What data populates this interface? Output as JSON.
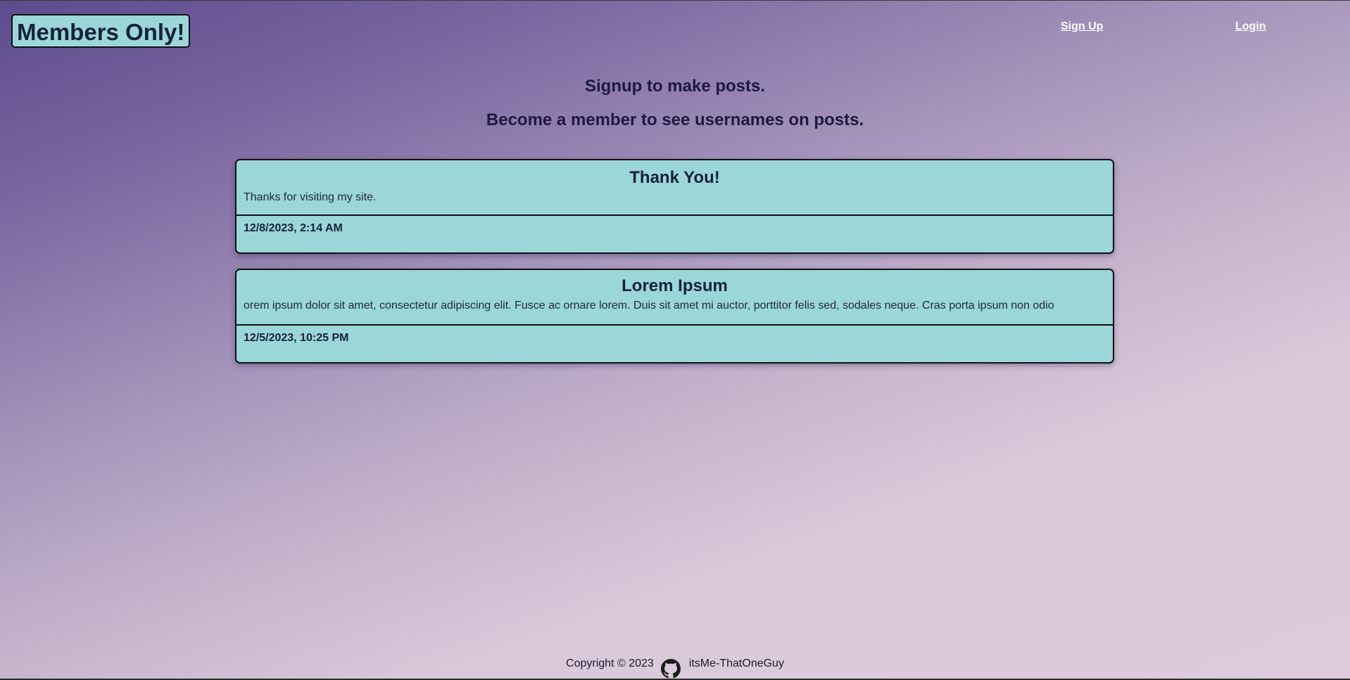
{
  "header": {
    "logo_text": "Members Only!",
    "nav": {
      "signup_label": "Sign Up",
      "login_label": "Login"
    }
  },
  "intro": {
    "line1": "Signup to make posts.",
    "line2": "Become a member to see usernames on posts."
  },
  "posts": [
    {
      "title": "Thank You!",
      "body": "Thanks for visiting my site.",
      "date": "12/8/2023, 2:14 AM"
    },
    {
      "title": "Lorem Ipsum",
      "body": "orem ipsum dolor sit amet, consectetur adipiscing elit. Fusce ac ornare lorem. Duis sit amet mi auctor, porttitor felis sed, sodales neque. Cras porta ipsum non odio",
      "date": "12/5/2023, 10:25 PM"
    }
  ],
  "footer": {
    "copyright": "Copyright © 2023",
    "icon": "github-icon",
    "username": "itsMe-ThatOneGuy"
  },
  "colors": {
    "card_bg": "#9bd6d8",
    "nav_link": "#ffffff",
    "text_dark": "#1d1a3f"
  }
}
